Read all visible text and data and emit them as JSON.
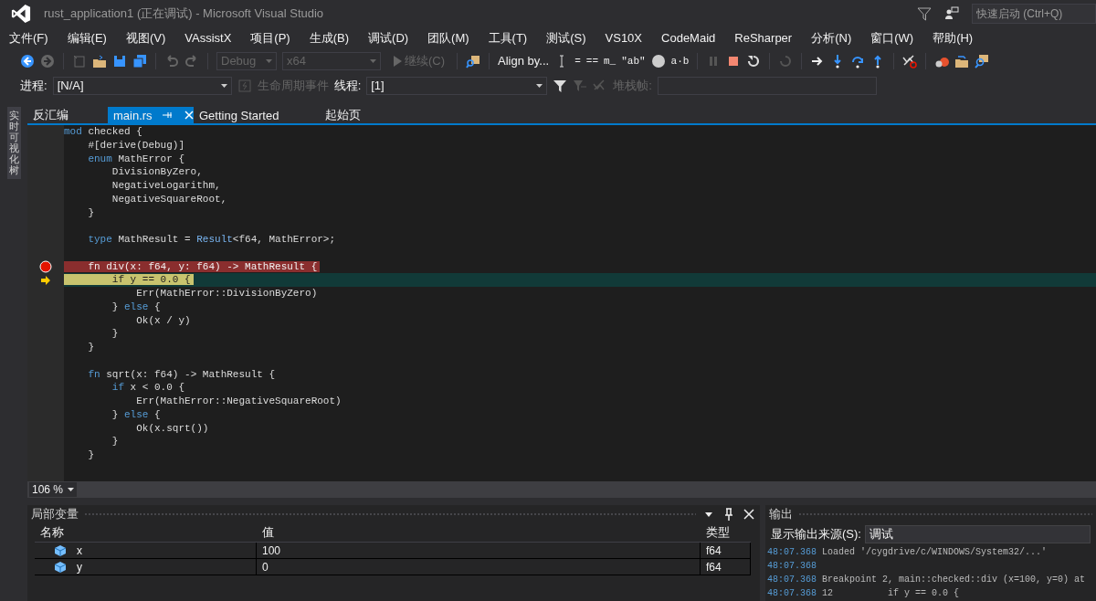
{
  "window": {
    "title": "rust_application1 (正在调试) - Microsoft Visual Studio"
  },
  "quick_launch": {
    "placeholder": "快速启动 (Ctrl+Q)"
  },
  "menu": [
    "文件(F)",
    "编辑(E)",
    "视图(V)",
    "VAssistX",
    "项目(P)",
    "生成(B)",
    "调试(D)",
    "团队(M)",
    "工具(T)",
    "测试(S)",
    "VS10X",
    "CodeMaid",
    "ReSharper",
    "分析(N)",
    "窗口(W)",
    "帮助(H)"
  ],
  "toolbar": {
    "configuration": {
      "text": "Debug",
      "disabled": true
    },
    "platform": {
      "text": "x64",
      "disabled": true
    },
    "continue": {
      "text": "继续(C)",
      "disabled": true
    },
    "align": "Align by...",
    "symbols": [
      "=",
      "==",
      "m_",
      "\"ab\"",
      "a·b"
    ]
  },
  "debug_bar": {
    "process_label": "进程:",
    "process": "[N/A]",
    "lifecycle": {
      "text": "生命周期事件",
      "disabled": true
    },
    "thread_label": "线程:",
    "thread": "[1]",
    "stack_label": {
      "text": "堆栈帧:",
      "disabled": true
    }
  },
  "side_tab": "实时可视化树",
  "tabs": [
    {
      "label": "反汇编",
      "selected": false
    },
    {
      "label": "main.rs",
      "selected": true
    },
    {
      "label": "Getting Started",
      "selected": false
    },
    {
      "label": "起始页",
      "selected": false
    }
  ],
  "editor": {
    "zoom": "106 %",
    "lines": [
      {
        "kind": "code",
        "segs": [
          {
            "kind": "keyword",
            "text": "mod"
          },
          {
            "kind": "plain",
            "text": " checked {"
          }
        ]
      },
      {
        "kind": "code",
        "segs": [
          {
            "kind": "plain",
            "text": "    #[derive(Debug)]"
          }
        ]
      },
      {
        "kind": "code",
        "segs": [
          {
            "kind": "keyword",
            "text": "    enum"
          },
          {
            "kind": "plain",
            "text": " MathError {"
          }
        ]
      },
      {
        "kind": "code",
        "segs": [
          {
            "kind": "plain",
            "text": "        DivisionByZero,"
          }
        ]
      },
      {
        "kind": "code",
        "segs": [
          {
            "kind": "plain",
            "text": "        NegativeLogarithm,"
          }
        ]
      },
      {
        "kind": "code",
        "segs": [
          {
            "kind": "plain",
            "text": "        NegativeSquareRoot,"
          }
        ]
      },
      {
        "kind": "code",
        "segs": [
          {
            "kind": "plain",
            "text": "    }"
          }
        ]
      },
      {
        "kind": "blank"
      },
      {
        "kind": "code",
        "segs": [
          {
            "kind": "keyword",
            "text": "    type"
          },
          {
            "kind": "plain",
            "text": " MathResult = "
          },
          {
            "kind": "type",
            "text": "Result"
          },
          {
            "kind": "plain",
            "text": "<f64, MathError>;"
          }
        ]
      },
      {
        "kind": "blank"
      },
      {
        "kind": "breakpoint",
        "segs": [
          {
            "kind": "plain",
            "text": "    fn div(x: f64, y: f64) -> MathResult {"
          }
        ]
      },
      {
        "kind": "current",
        "segs": [
          {
            "kind": "plain",
            "text": "        if y == 0.0 {"
          }
        ]
      },
      {
        "kind": "code",
        "segs": [
          {
            "kind": "plain",
            "text": "            Err(MathError::DivisionByZero)"
          }
        ]
      },
      {
        "kind": "code",
        "segs": [
          {
            "kind": "plain",
            "text": "        } "
          },
          {
            "kind": "keyword",
            "text": "else"
          },
          {
            "kind": "plain",
            "text": " {"
          }
        ]
      },
      {
        "kind": "code",
        "segs": [
          {
            "kind": "plain",
            "text": "            Ok(x / y)"
          }
        ]
      },
      {
        "kind": "code",
        "segs": [
          {
            "kind": "plain",
            "text": "        }"
          }
        ]
      },
      {
        "kind": "code",
        "segs": [
          {
            "kind": "plain",
            "text": "    }"
          }
        ]
      },
      {
        "kind": "blank"
      },
      {
        "kind": "code",
        "segs": [
          {
            "kind": "keyword",
            "text": "    fn"
          },
          {
            "kind": "plain",
            "text": " sqrt(x: f64) -> MathResult {"
          }
        ]
      },
      {
        "kind": "code",
        "segs": [
          {
            "kind": "keyword",
            "text": "        if"
          },
          {
            "kind": "plain",
            "text": " x < 0.0 {"
          }
        ]
      },
      {
        "kind": "code",
        "segs": [
          {
            "kind": "plain",
            "text": "            Err(MathError::NegativeSquareRoot)"
          }
        ]
      },
      {
        "kind": "code",
        "segs": [
          {
            "kind": "plain",
            "text": "        } "
          },
          {
            "kind": "keyword",
            "text": "else"
          },
          {
            "kind": "plain",
            "text": " {"
          }
        ]
      },
      {
        "kind": "code",
        "segs": [
          {
            "kind": "plain",
            "text": "            Ok(x.sqrt())"
          }
        ]
      },
      {
        "kind": "code",
        "segs": [
          {
            "kind": "plain",
            "text": "        }"
          }
        ]
      },
      {
        "kind": "code",
        "segs": [
          {
            "kind": "plain",
            "text": "    }"
          }
        ]
      },
      {
        "kind": "blank"
      }
    ]
  },
  "locals": {
    "title": "局部变量",
    "columns": [
      "名称",
      "值",
      "类型"
    ],
    "rows": [
      {
        "name": "x",
        "value": "100",
        "type": "f64"
      },
      {
        "name": "y",
        "value": "0",
        "type": "f64"
      }
    ]
  },
  "output": {
    "title": "输出",
    "source_label": "显示输出来源(S):",
    "source": "调试",
    "lines": [
      {
        "time": "48:07.368",
        "text": "Loaded '/cygdrive/c/WINDOWS/System32/...'"
      },
      {
        "time": "48:07.368"
      },
      {
        "time": "48:07.368",
        "text": "Breakpoint 2, main::checked::div (x=100, y=0) at"
      },
      {
        "time": "48:07.368",
        "text": "12          if y == 0.0 {"
      }
    ]
  }
}
